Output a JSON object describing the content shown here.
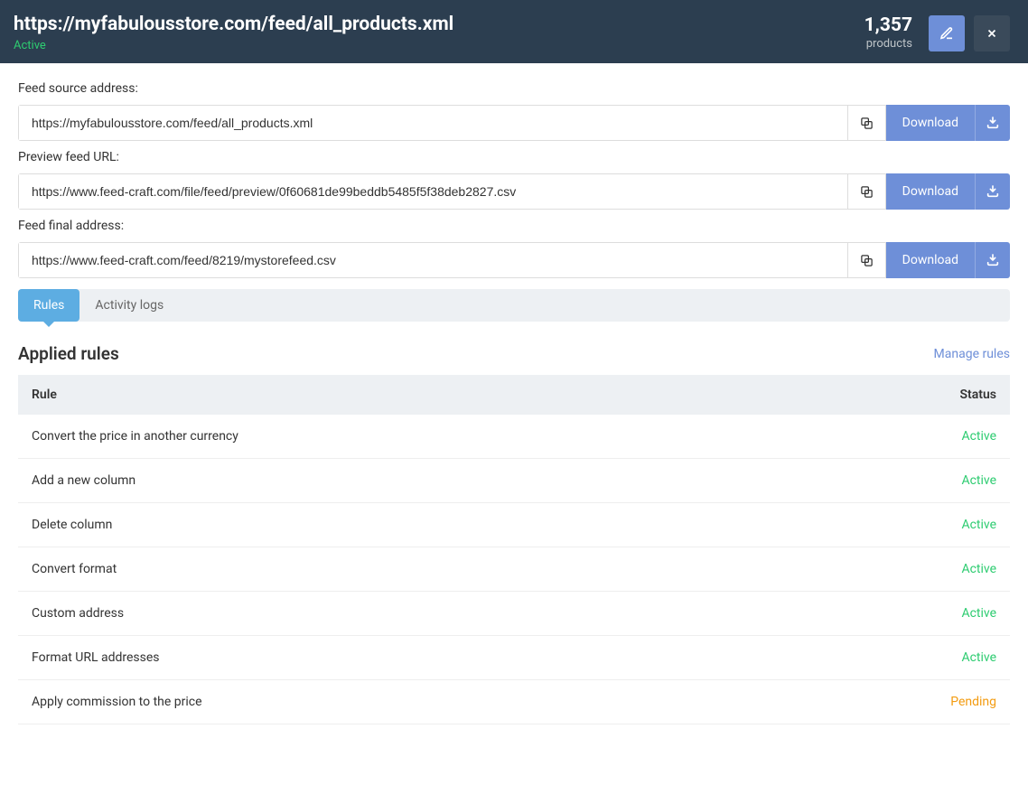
{
  "header": {
    "title": "https://myfabulousstore.com/feed/all_products.xml",
    "status": "Active",
    "products_count": "1,357",
    "products_label": "products"
  },
  "fields": {
    "source": {
      "label": "Feed source address:",
      "value": "https://myfabulousstore.com/feed/all_products.xml",
      "download": "Download"
    },
    "preview": {
      "label": "Preview feed URL:",
      "value": "https://www.feed-craft.com/file/feed/preview/0f60681de99beddb5485f5f38deb2827.csv",
      "download": "Download"
    },
    "final": {
      "label": "Feed final address:",
      "value": "https://www.feed-craft.com/feed/8219/mystorefeed.csv",
      "download": "Download"
    }
  },
  "tabs": {
    "rules": "Rules",
    "activity": "Activity logs"
  },
  "section": {
    "title": "Applied rules",
    "manage": "Manage rules"
  },
  "table": {
    "head_rule": "Rule",
    "head_status": "Status",
    "rows": [
      {
        "name": "Convert the price in another currency",
        "status": "Active",
        "cls": "active"
      },
      {
        "name": "Add a new column",
        "status": "Active",
        "cls": "active"
      },
      {
        "name": "Delete column",
        "status": "Active",
        "cls": "active"
      },
      {
        "name": "Convert format",
        "status": "Active",
        "cls": "active"
      },
      {
        "name": "Custom address",
        "status": "Active",
        "cls": "active"
      },
      {
        "name": "Format URL addresses",
        "status": "Active",
        "cls": "active"
      },
      {
        "name": "Apply commission to the price",
        "status": "Pending",
        "cls": "pending"
      }
    ]
  }
}
